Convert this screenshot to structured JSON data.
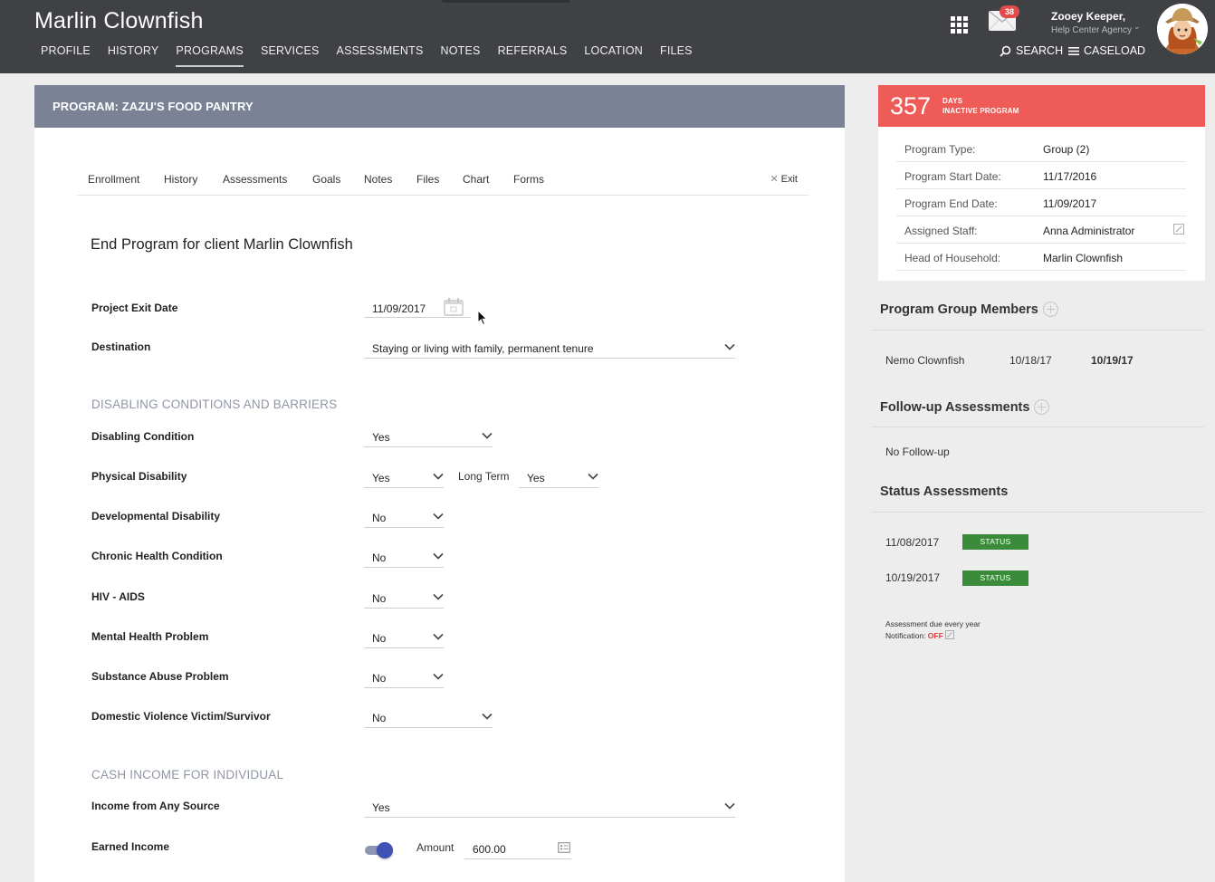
{
  "header": {
    "client_name": "Marlin Clownfish",
    "nav": [
      "PROFILE",
      "HISTORY",
      "PROGRAMS",
      "SERVICES",
      "ASSESSMENTS",
      "NOTES",
      "REFERRALS",
      "LOCATION",
      "FILES"
    ],
    "active_nav": "PROGRAMS",
    "mail_count": "38",
    "user_name": "Zooey Keeper,",
    "user_agency": "Help Center Agency",
    "search_label": "SEARCH",
    "caseload_label": "CASELOAD",
    "icons": [
      "apps-grid-icon",
      "mail-icon",
      "search-icon",
      "menu-icon",
      "chevron-down-icon"
    ]
  },
  "program": {
    "header_title": "PROGRAM: ZAZU'S FOOD PANTRY",
    "tabs": [
      "Enrollment",
      "History",
      "Assessments",
      "Goals",
      "Notes",
      "Files",
      "Chart",
      "Forms"
    ],
    "exit_label": "Exit"
  },
  "form": {
    "title": "End Program for client Marlin Clownfish",
    "exit_date_label": "Project Exit Date",
    "exit_date_value": "11/09/2017",
    "destination_label": "Destination",
    "destination_value": "Staying or living with family, permanent tenure",
    "disabling_section": "DISABLING CONDITIONS AND BARRIERS",
    "disabling_condition_label": "Disabling Condition",
    "disabling_condition_value": "Yes",
    "physical_label": "Physical Disability",
    "physical_value": "Yes",
    "long_term_label": "Long Term",
    "long_term_value": "Yes",
    "developmental_label": "Developmental Disability",
    "developmental_value": "No",
    "chronic_label": "Chronic Health Condition",
    "chronic_value": "No",
    "hiv_label": "HIV - AIDS",
    "hiv_value": "No",
    "mental_label": "Mental Health Problem",
    "mental_value": "No",
    "substance_label": "Substance Abuse Problem",
    "substance_value": "No",
    "domestic_label": "Domestic Violence Victim/Survivor",
    "domestic_value": "No",
    "income_section": "CASH INCOME FOR INDIVIDUAL",
    "income_any_label": "Income from Any Source",
    "income_any_value": "Yes",
    "earned_label": "Earned Income",
    "earned_toggle_on": true,
    "amount_label": "Amount",
    "amount_value": "600.00"
  },
  "side": {
    "days_value": "357",
    "days_unit_1": "DAYS",
    "days_unit_2": "INACTIVE PROGRAM",
    "info": {
      "type_label": "Program Type:",
      "type_value": "Group (2)",
      "start_label": "Program Start Date:",
      "start_value": "11/17/2016",
      "end_label": "Program End Date:",
      "end_value": "11/09/2017",
      "staff_label": "Assigned Staff:",
      "staff_value": "Anna Administrator",
      "head_label": "Head of Household:",
      "head_value": "Marlin Clownfish"
    },
    "group_members_heading": "Program Group Members",
    "member_name": "Nemo Clownfish",
    "member_start": "10/18/17",
    "member_end": "10/19/17",
    "followup_heading": "Follow-up Assessments",
    "followup_text": "No Follow-up",
    "status_heading": "Status Assessments",
    "status_1_date": "11/08/2017",
    "status_2_date": "10/19/2017",
    "status_badge": "STATUS",
    "due_note": "Assessment due every year",
    "notification_label": "Notification:",
    "notification_value": "OFF"
  },
  "colors": {
    "topbar": "#3f4145",
    "program_header": "#7b8296",
    "days_banner": "#ef5b57",
    "status_badge": "#3a8c3a",
    "section_head": "#8f96a6",
    "toggle_knob": "#3f51b5"
  }
}
